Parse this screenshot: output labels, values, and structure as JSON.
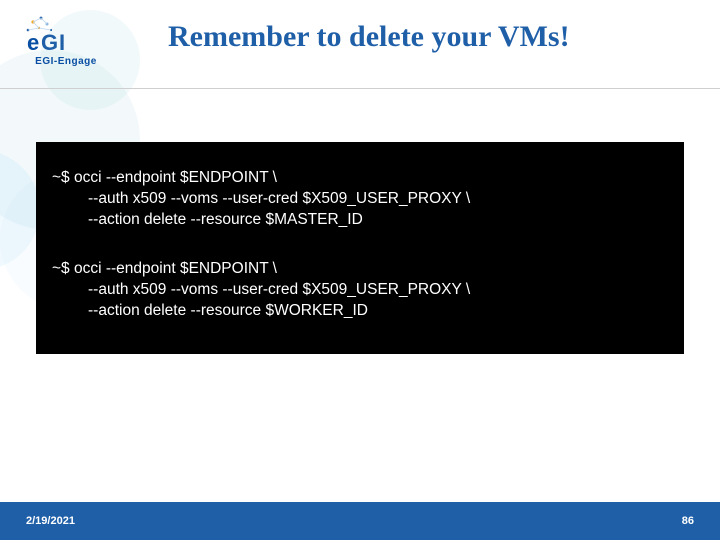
{
  "logo": {
    "name": "eGI",
    "subtext": "EGI-Engage"
  },
  "title": "Remember to delete your VMs!",
  "terminal": {
    "block1": {
      "line1": "~$ occi --endpoint $ENDPOINT \\",
      "line2": "--auth x509 --voms --user-cred $X509_USER_PROXY \\",
      "line3": "--action delete --resource $MASTER_ID"
    },
    "block2": {
      "line1": "~$ occi --endpoint $ENDPOINT \\",
      "line2": "--auth x509 --voms --user-cred $X509_USER_PROXY \\",
      "line3": "--action delete --resource $WORKER_ID"
    }
  },
  "footer": {
    "date": "2/19/2021",
    "page": "86"
  }
}
